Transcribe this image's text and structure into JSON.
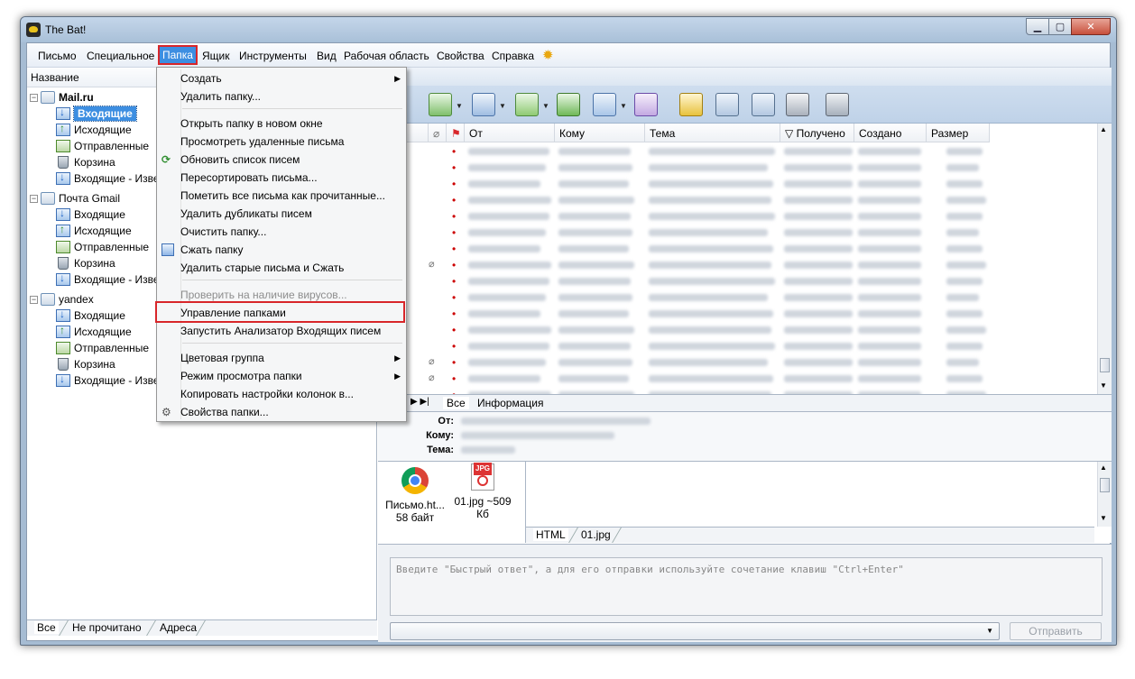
{
  "window": {
    "title": "The Bat!"
  },
  "menubar": {
    "items": [
      "Письмо",
      "Специальное",
      "Папка",
      "Ящик",
      "Инструменты",
      "Вид",
      "Рабочая область",
      "Свойства",
      "Справка"
    ],
    "active": "Папка"
  },
  "tree": {
    "header": "Название",
    "accounts": [
      {
        "name": "Mail.ru",
        "folders": [
          "Входящие",
          "Исходящие",
          "Отправленные",
          "Корзина",
          "Входящие - Изве"
        ]
      },
      {
        "name": "Почта Gmail",
        "folders": [
          "Входящие",
          "Исходящие",
          "Отправленные",
          "Корзина",
          "Входящие - Изве"
        ]
      },
      {
        "name": "yandex",
        "folders": [
          "Входящие",
          "Исходящие",
          "Отправленные",
          "Корзина",
          "Входящие - Изве"
        ]
      }
    ],
    "selected": "Mail.ru / Входящие",
    "bottom_tabs": [
      "Все",
      "Не прочитано",
      "Адреса"
    ]
  },
  "message_list": {
    "columns": [
      "От",
      "Кому",
      "Тема",
      "Получено",
      "Создано",
      "Размер"
    ],
    "sort_column": "Получено"
  },
  "preview": {
    "tabs": [
      "Все",
      "Информация"
    ],
    "header_labels": {
      "from": "От:",
      "to": "Кому:",
      "subject": "Тема:"
    },
    "attachments": [
      {
        "name": "Письмо.ht...",
        "size": "58 байт",
        "icon": "chrome-icon"
      },
      {
        "name": "01.jpg ~509",
        "size": "Кб",
        "icon": "jpg-file-icon"
      }
    ],
    "viewer_tabs": [
      "HTML",
      "01.jpg"
    ]
  },
  "quick_reply": {
    "placeholder": "Введите \"Быстрый ответ\", а для его отправки используйте сочетание клавиш \"Ctrl+Enter\"",
    "send_label": "Отправить"
  },
  "context_menu": {
    "items": [
      {
        "label": "Создать",
        "submenu": true
      },
      {
        "label": "Удалить папку..."
      },
      {
        "sep": true
      },
      {
        "label": "Открыть папку в новом окне"
      },
      {
        "label": "Просмотреть удаленные письма"
      },
      {
        "label": "Обновить список писем",
        "icon": "refresh-icon"
      },
      {
        "label": "Пересортировать письма..."
      },
      {
        "label": "Пометить все письма как прочитанные..."
      },
      {
        "label": "Удалить дубликаты писем"
      },
      {
        "label": "Очистить папку..."
      },
      {
        "label": "Сжать папку",
        "icon": "compress-icon"
      },
      {
        "label": "Удалить старые письма и Сжать"
      },
      {
        "sep": true
      },
      {
        "label": "Проверить на наличие вирусов...",
        "disabled": true
      },
      {
        "label": "Управление папками",
        "highlighted": true
      },
      {
        "label": "Запустить Анализатор Входящих писем"
      },
      {
        "sep": true
      },
      {
        "label": "Цветовая группа",
        "submenu": true
      },
      {
        "label": "Режим просмотра папки",
        "submenu": true
      },
      {
        "label": "Копировать настройки колонок в..."
      },
      {
        "label": "Свойства папки...",
        "icon": "properties-icon"
      }
    ]
  },
  "colors": {
    "selection": "#3d8ee1",
    "highlight_box": "#d8262a",
    "flag": "#cc0000"
  }
}
